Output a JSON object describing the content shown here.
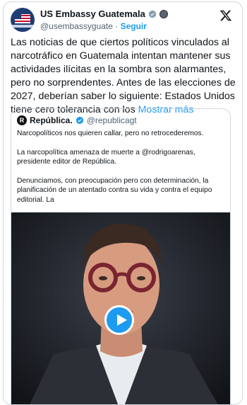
{
  "author": {
    "name": "US Embassy Guatemala",
    "handle": "@usembassyguate",
    "separator": "·",
    "follow_label": "Seguir"
  },
  "tweet": {
    "text": "Las noticias de que ciertos políticos vinculados al narcotráfico en Guatemala intentan mantener sus actividades ilícitas en la sombra son alarmantes, pero no sorprendentes. Antes de las elecciones de 2027, deberían saber lo siguiente: Estados Unidos tiene cero tolerancia con los ",
    "show_more": "Mostrar más"
  },
  "quoted": {
    "avatar_letter": "R",
    "name": "República.",
    "handle": "@republicagt",
    "paragraphs": [
      "Narcopolíticos nos quieren callar, pero no retrocederemos.",
      "La narcopolítica amenaza de muerte a @rodrigoarenas, presidente editor de República.",
      "Denunciamos, con preocupación pero con determinación, la planificación de un atentado contra su vida y contra el equipo editorial. La"
    ]
  },
  "media": {
    "type": "video",
    "icon": "play-icon"
  },
  "colors": {
    "accent": "#1d9bf0",
    "text": "#0f1419",
    "muted": "#536471",
    "border": "#cfd9de"
  }
}
